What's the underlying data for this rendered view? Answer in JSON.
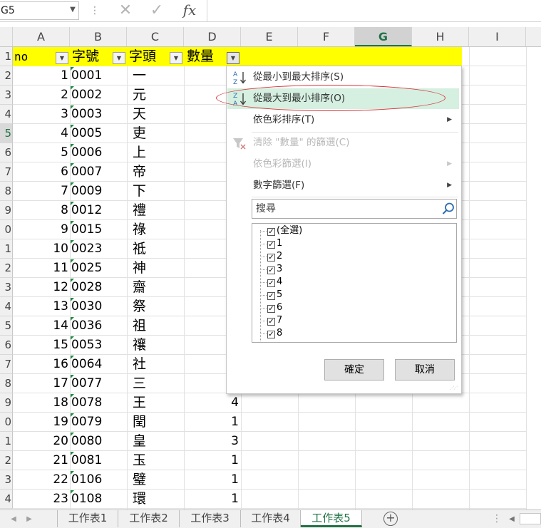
{
  "formula_bar": {
    "name_box": "G5",
    "fx": "fx"
  },
  "columns": [
    "A",
    "B",
    "C",
    "D",
    "E",
    "F",
    "G",
    "H",
    "I"
  ],
  "selected_column": "G",
  "selected_row": "5",
  "row_numbers": [
    "1",
    "2",
    "3",
    "4",
    "5",
    "6",
    "7",
    "8",
    "9",
    "0",
    "1",
    "2",
    "3",
    "4",
    "5",
    "6",
    "7",
    "8",
    "9",
    "0",
    "1",
    "2",
    "3",
    "4"
  ],
  "headers": {
    "a": "no",
    "b": "字號",
    "c": "字頭",
    "d": "數量"
  },
  "rows": [
    {
      "no": "1",
      "code": "0001",
      "char": "一",
      "qty": ""
    },
    {
      "no": "2",
      "code": "0002",
      "char": "元",
      "qty": ""
    },
    {
      "no": "3",
      "code": "0003",
      "char": "天",
      "qty": ""
    },
    {
      "no": "4",
      "code": "0005",
      "char": "吏",
      "qty": ""
    },
    {
      "no": "5",
      "code": "0006",
      "char": "上",
      "qty": ""
    },
    {
      "no": "6",
      "code": "0007",
      "char": "帝",
      "qty": ""
    },
    {
      "no": "7",
      "code": "0009",
      "char": "下",
      "qty": ""
    },
    {
      "no": "8",
      "code": "0012",
      "char": "禮",
      "qty": ""
    },
    {
      "no": "9",
      "code": "0015",
      "char": "祿",
      "qty": ""
    },
    {
      "no": "10",
      "code": "0023",
      "char": "祗",
      "qty": ""
    },
    {
      "no": "11",
      "code": "0025",
      "char": "神",
      "qty": ""
    },
    {
      "no": "12",
      "code": "0028",
      "char": "齋",
      "qty": ""
    },
    {
      "no": "13",
      "code": "0030",
      "char": "祭",
      "qty": ""
    },
    {
      "no": "14",
      "code": "0036",
      "char": "祖",
      "qty": ""
    },
    {
      "no": "15",
      "code": "0053",
      "char": "禳",
      "qty": ""
    },
    {
      "no": "16",
      "code": "0064",
      "char": "社",
      "qty": ""
    },
    {
      "no": "17",
      "code": "0077",
      "char": "三",
      "qty": ""
    },
    {
      "no": "18",
      "code": "0078",
      "char": "王",
      "qty": "4"
    },
    {
      "no": "19",
      "code": "0079",
      "char": "閏",
      "qty": "1"
    },
    {
      "no": "20",
      "code": "0080",
      "char": "皇",
      "qty": "3"
    },
    {
      "no": "21",
      "code": "0081",
      "char": "玉",
      "qty": "1"
    },
    {
      "no": "22",
      "code": "0106",
      "char": "璧",
      "qty": "1"
    },
    {
      "no": "23",
      "code": "0108",
      "char": "環",
      "qty": "1"
    }
  ],
  "filter_menu": {
    "sort_asc": "從最小到最大排序(S)",
    "sort_desc": "從最大到最小排序(O)",
    "sort_by_color": "依色彩排序(T)",
    "clear_filter": "清除 \"數量\" 的篩選(C)",
    "filter_by_color": "依色彩篩選(I)",
    "number_filters": "數字篩選(F)",
    "search_placeholder": "搜尋",
    "list_items": [
      "(全選)",
      "1",
      "2",
      "3",
      "4",
      "5",
      "6",
      "7",
      "8"
    ],
    "ok": "確定",
    "cancel": "取消"
  },
  "sheet_tabs": [
    "工作表1",
    "工作表2",
    "工作表3",
    "工作表4",
    "工作表5"
  ],
  "active_sheet": "工作表5",
  "colors": {
    "excel_green": "#217346",
    "header_yellow": "#ffff00",
    "highlight": "#d5efe0",
    "annotation_red": "#d9353a"
  }
}
